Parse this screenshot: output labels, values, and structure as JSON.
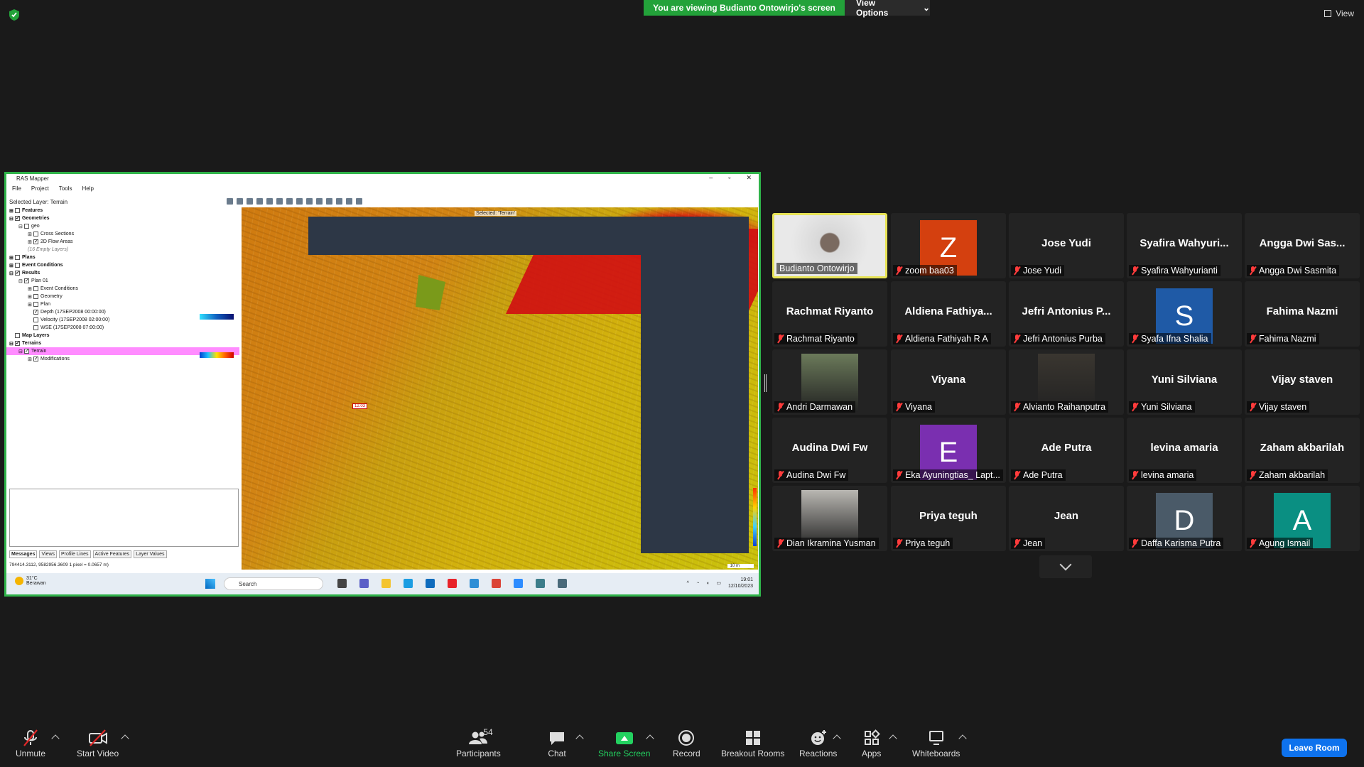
{
  "top": {
    "viewing_banner": "You are viewing Budianto Ontowirjo's screen",
    "view_options": "View Options",
    "view_button": "View"
  },
  "shared_app": {
    "title": "RAS Mapper",
    "menu": [
      "File",
      "Project",
      "Tools",
      "Help"
    ],
    "selected_layer": "Selected Layer: Terrain",
    "map_selected_label": "Selected: 'Terrain'",
    "tree": [
      {
        "label": "Features",
        "bold": true,
        "indent": 0,
        "checked": false,
        "expander": "+"
      },
      {
        "label": "Geometries",
        "bold": true,
        "indent": 0,
        "checked": true,
        "expander": "-"
      },
      {
        "label": "geo",
        "bold": false,
        "indent": 1,
        "checked": false,
        "expander": "-"
      },
      {
        "label": "Cross Sections",
        "bold": false,
        "indent": 2,
        "checked": false,
        "expander": "+"
      },
      {
        "label": "2D Flow Areas",
        "bold": false,
        "indent": 2,
        "checked": true,
        "expander": "+"
      },
      {
        "label": "(16 Empty Layers)",
        "italic": true,
        "indent": 2
      },
      {
        "label": "Plans",
        "bold": true,
        "indent": 0,
        "checked": false,
        "expander": "+"
      },
      {
        "label": "Event Conditions",
        "bold": true,
        "indent": 0,
        "checked": false,
        "expander": "+"
      },
      {
        "label": "Results",
        "bold": true,
        "indent": 0,
        "checked": true,
        "expander": "-"
      },
      {
        "label": "Plan 01",
        "bold": false,
        "indent": 1,
        "checked": true,
        "expander": "-"
      },
      {
        "label": "Event Conditions",
        "bold": false,
        "indent": 2,
        "checked": false,
        "expander": "+"
      },
      {
        "label": "Geometry",
        "bold": false,
        "indent": 2,
        "checked": false,
        "expander": "+"
      },
      {
        "label": "Plan",
        "bold": false,
        "indent": 2,
        "checked": false,
        "expander": "+"
      },
      {
        "label": "Depth (17SEP2008 00:00:00)",
        "bold": false,
        "indent": 2,
        "checked": true,
        "expander": ""
      },
      {
        "label": "Velocity (17SEP2008 02:00:00)",
        "bold": false,
        "indent": 2,
        "checked": false,
        "expander": ""
      },
      {
        "label": "WSE (17SEP2008 07:00:00)",
        "bold": false,
        "indent": 2,
        "checked": false,
        "expander": ""
      },
      {
        "label": "Map Layers",
        "bold": true,
        "indent": 0,
        "checked": false,
        "expander": ""
      },
      {
        "label": "Terrains",
        "bold": true,
        "indent": 0,
        "checked": true,
        "expander": "-"
      },
      {
        "label": "Terrain",
        "bold": false,
        "indent": 1,
        "checked": true,
        "expander": "-",
        "highlight": true
      },
      {
        "label": "Modifications",
        "bold": false,
        "indent": 2,
        "checked": true,
        "expander": "+"
      }
    ],
    "bottom_tabs": [
      "Messages",
      "Views",
      "Profile Lines",
      "Active Features",
      "Layer Values"
    ],
    "coords": "794414.3112, 9582956.3609  1 pixel = 0.0657 m)",
    "map_value_label": "12.03",
    "scale_label": "10 m",
    "taskbar": {
      "temp": "31°C",
      "weather": "Berawan",
      "search": "Search",
      "time": "19:01",
      "date": "12/10/2023"
    }
  },
  "participants": [
    {
      "big": "",
      "label": "Budianto Ontowirjo",
      "muted": false,
      "kind": "video",
      "active": true
    },
    {
      "big": "Z",
      "label": "zoom baa03",
      "muted": true,
      "kind": "letter",
      "color": "#d4400f"
    },
    {
      "big": "Jose Yudi",
      "label": "Jose Yudi",
      "muted": true,
      "kind": "name"
    },
    {
      "big": "Syafira  Wahyuri...",
      "label": "Syafira Wahyurianti",
      "muted": true,
      "kind": "name"
    },
    {
      "big": "Angga Dwi Sas...",
      "label": "Angga Dwi Sasmita",
      "muted": true,
      "kind": "name"
    },
    {
      "big": "Rachmat Riyanto",
      "label": "Rachmat Riyanto",
      "muted": true,
      "kind": "name"
    },
    {
      "big": "Aldiena  Fathiya...",
      "label": "Aldiena Fathiyah R A",
      "muted": true,
      "kind": "name"
    },
    {
      "big": "Jefri Antonius P...",
      "label": "Jefri Antonius Purba",
      "muted": true,
      "kind": "name"
    },
    {
      "big": "S",
      "label": "Syafa Ifna Shalia",
      "muted": true,
      "kind": "letter",
      "color": "#1f5aa6"
    },
    {
      "big": "Fahima Nazmi",
      "label": "Fahima Nazmi",
      "muted": true,
      "kind": "name"
    },
    {
      "big": "",
      "label": "Andri Darmawan",
      "muted": true,
      "kind": "photo",
      "color": "#6b7a5a"
    },
    {
      "big": "Viyana",
      "label": "Viyana",
      "muted": true,
      "kind": "name"
    },
    {
      "big": "",
      "label": "Alvianto Raihanputra",
      "muted": true,
      "kind": "photo",
      "color": "#3a3630"
    },
    {
      "big": "Yuni Silviana",
      "label": "Yuni Silviana",
      "muted": true,
      "kind": "name"
    },
    {
      "big": "Vijay staven",
      "label": "Vijay staven",
      "muted": true,
      "kind": "name"
    },
    {
      "big": "Audina Dwi Fw",
      "label": "Audina Dwi Fw",
      "muted": true,
      "kind": "name"
    },
    {
      "big": "E",
      "label": "Eka Ayuningtias_ Lapt...",
      "muted": true,
      "kind": "letter",
      "color": "#7a2fb0"
    },
    {
      "big": "Ade Putra",
      "label": "Ade Putra",
      "muted": true,
      "kind": "name"
    },
    {
      "big": "levina amaria",
      "label": "levina amaria",
      "muted": true,
      "kind": "name"
    },
    {
      "big": "Zaham akbarilah",
      "label": "Zaham akbarilah",
      "muted": true,
      "kind": "name"
    },
    {
      "big": "",
      "label": "Dian Ikramina Yusman",
      "muted": true,
      "kind": "photo",
      "color": "#b9b7b2"
    },
    {
      "big": "Priya teguh",
      "label": "Priya teguh",
      "muted": true,
      "kind": "name"
    },
    {
      "big": "Jean",
      "label": "Jean",
      "muted": true,
      "kind": "name"
    },
    {
      "big": "D",
      "label": "Daffa Karisma Putra",
      "muted": true,
      "kind": "letter",
      "color": "#4a5a68"
    },
    {
      "big": "A",
      "label": "Agung Ismail",
      "muted": true,
      "kind": "letter",
      "color": "#0a8f82"
    }
  ],
  "toolbar": {
    "unmute": "Unmute",
    "start_video": "Start Video",
    "participants": "Participants",
    "participants_count": "54",
    "chat": "Chat",
    "share_screen": "Share Screen",
    "record": "Record",
    "breakout": "Breakout Rooms",
    "reactions": "Reactions",
    "apps": "Apps",
    "whiteboards": "Whiteboards",
    "leave": "Leave Room"
  }
}
